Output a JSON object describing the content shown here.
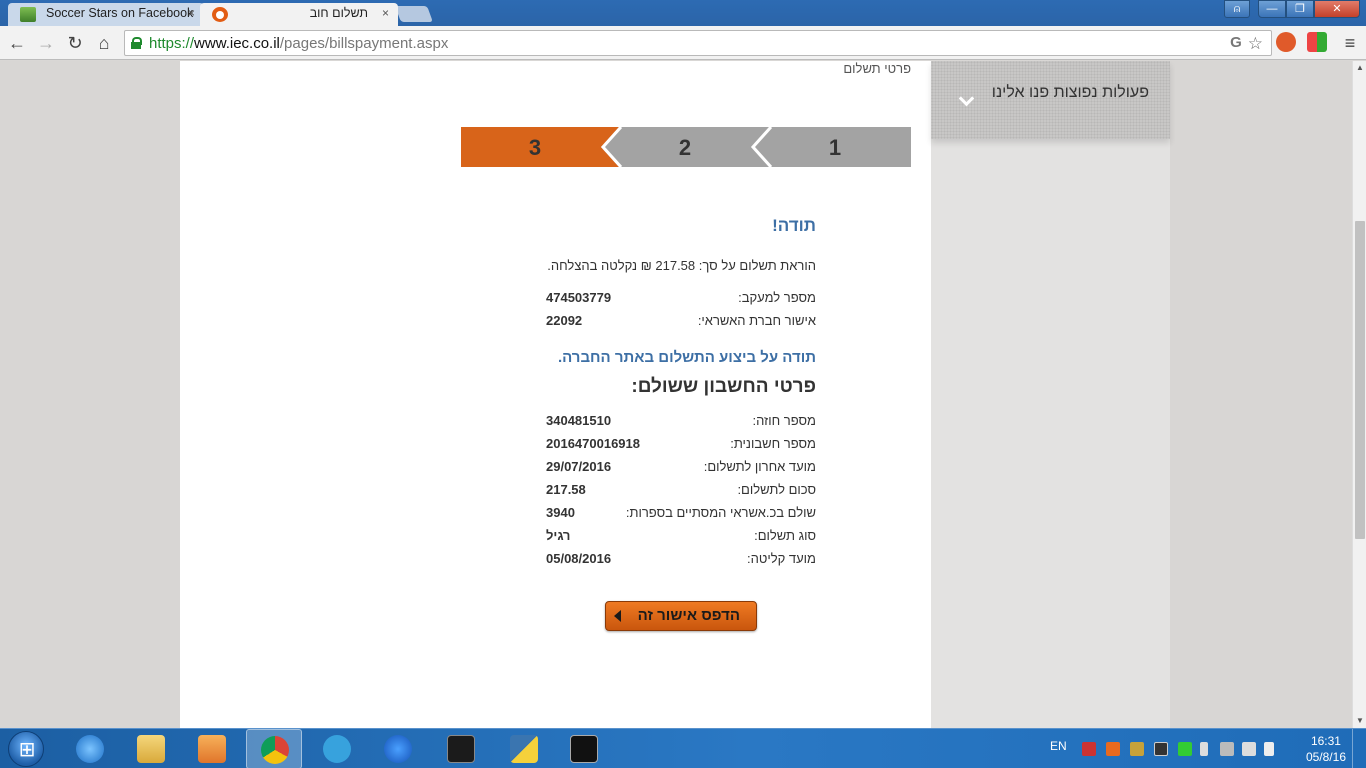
{
  "browser": {
    "tabs": [
      {
        "title": "Soccer Stars on Facebook",
        "close": "×"
      },
      {
        "title": "תשלום חוב",
        "close": "×"
      }
    ],
    "window_controls": {
      "user": "⍝",
      "minimize": "—",
      "maximize": "❐",
      "close": "✕"
    },
    "nav": {
      "back": "←",
      "forward": "→",
      "reload": "↻",
      "home": "⌂"
    },
    "url": {
      "scheme": "https://",
      "host": "www.iec.co.il",
      "path": "/pages/billspayment.aspx"
    },
    "omnibox_icons": {
      "translate": "G",
      "star": "☆"
    },
    "menu": "≡"
  },
  "sidebar": {
    "title": "פעולות נפוצות פנו אלינו"
  },
  "breadcrumb": "פרטי תשלום",
  "steps": [
    {
      "number": "1",
      "state": "done"
    },
    {
      "number": "2",
      "state": "done"
    },
    {
      "number": "3",
      "state": "active"
    }
  ],
  "confirmation": {
    "thanks": "תודה!",
    "message": "הוראת תשלום על סך: 217.58 ₪ נקלטה בהצלחה.",
    "tracking_label": "מספר למעקב:",
    "tracking_value": "474503779",
    "approval_label": "אישור חברת האשראי:",
    "approval_value": "22092"
  },
  "thanks_site": "תודה על ביצוע התשלום באתר החברה.",
  "bill": {
    "heading": "פרטי החשבון ששולם:",
    "rows": [
      {
        "label": "מספר חוזה:",
        "value": "340481510"
      },
      {
        "label": "מספר חשבונית:",
        "value": "2016470016918"
      },
      {
        "label": "מועד אחרון לתשלום:",
        "value": "29/07/2016"
      },
      {
        "label": "סכום לתשלום:",
        "value": "217.58"
      },
      {
        "label": "שולם בכ.אשראי המסתיים בספרות:",
        "value": "3940"
      },
      {
        "label": "סוג תשלום:",
        "value": "רגיל"
      },
      {
        "label": "מועד קליטה:",
        "value": "05/08/2016"
      }
    ]
  },
  "print_button": "הדפס אישור זה",
  "taskbar": {
    "language": "EN",
    "time": "16:31",
    "date": "05/8/16"
  },
  "colors": {
    "accent_orange": "#d8641a",
    "link_blue": "#3d6fa5",
    "step_gray": "#a3a3a3"
  }
}
